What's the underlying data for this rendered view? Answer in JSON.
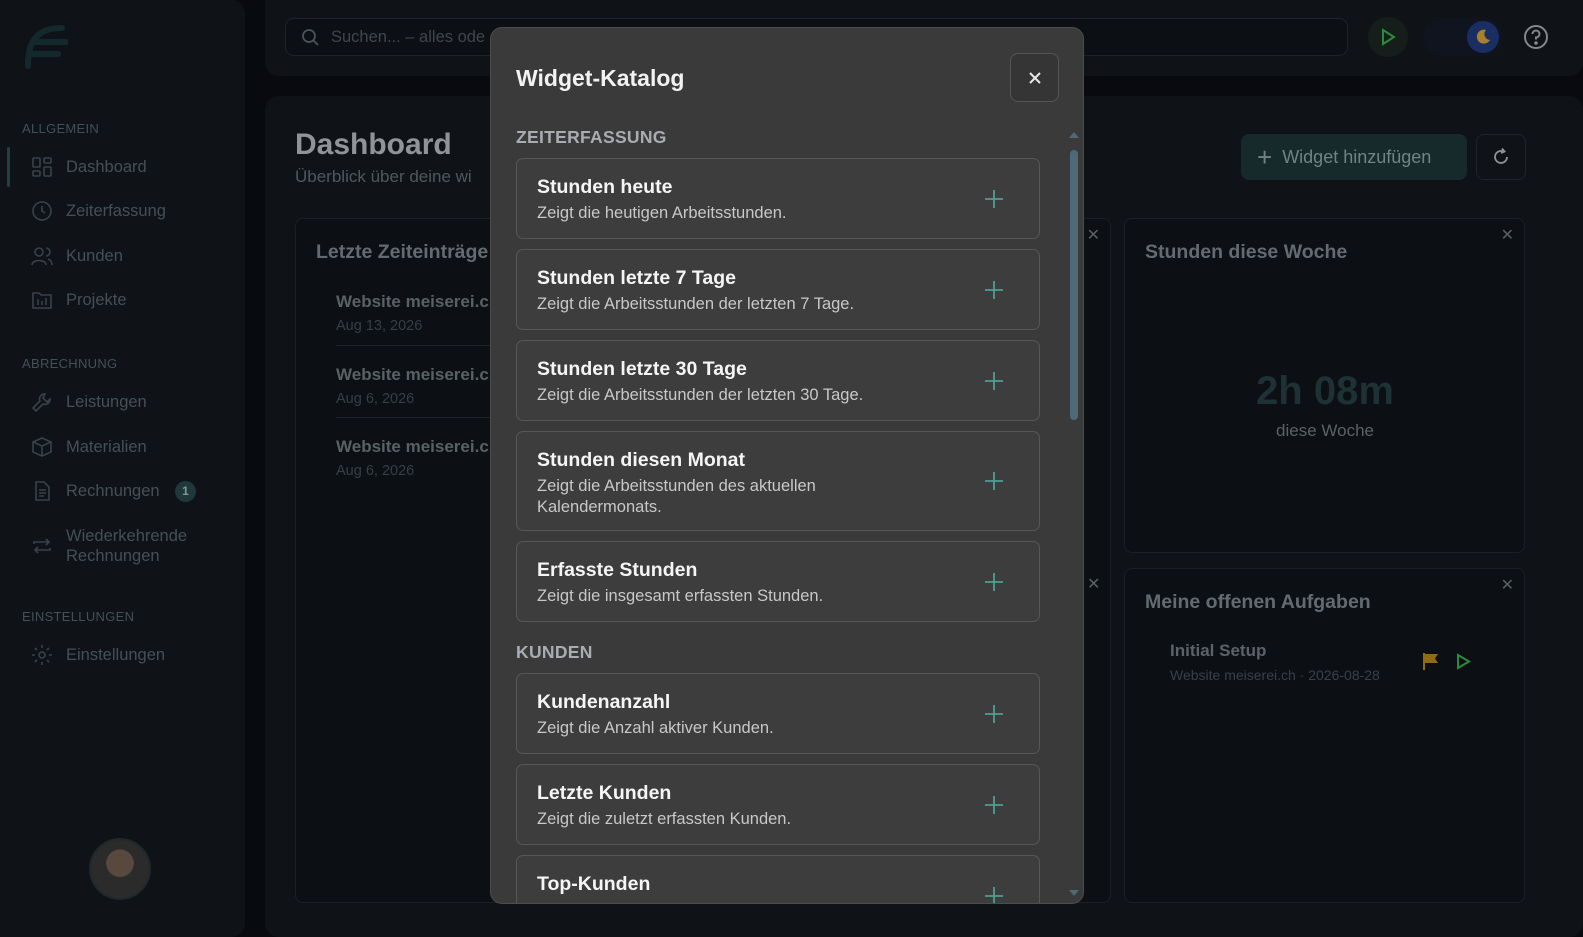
{
  "colors": {
    "accent": "#2b5a5c",
    "modal_bg": "#3a3a3a",
    "play_green": "#3fbf4f",
    "flag_yellow": "#c8951b"
  },
  "sidebar": {
    "sections": [
      {
        "label": "ALLGEMEIN"
      },
      {
        "label": "ABRECHNUNG"
      },
      {
        "label": "EINSTELLUNGEN"
      }
    ],
    "items": [
      {
        "label": "Dashboard",
        "icon": "dashboard-icon"
      },
      {
        "label": "Zeiterfassung",
        "icon": "clock-icon"
      },
      {
        "label": "Kunden",
        "icon": "users-icon"
      },
      {
        "label": "Projekte",
        "icon": "projects-icon"
      },
      {
        "label": "Leistungen",
        "icon": "wrench-icon"
      },
      {
        "label": "Materialien",
        "icon": "box-icon"
      },
      {
        "label": "Rechnungen",
        "icon": "document-icon",
        "badge": "1"
      },
      {
        "label": "Wiederkehrende Rechnungen",
        "icon": "repeat-icon"
      },
      {
        "label": "Einstellungen",
        "icon": "gear-icon"
      }
    ]
  },
  "topbar": {
    "search_placeholder": "Suchen... – alles ode"
  },
  "main": {
    "title": "Dashboard",
    "subtitle": "Überblick über deine wi",
    "add_widget_label": "Widget hinzufügen",
    "cards": {
      "recent": {
        "title": "Letzte Zeiteinträge",
        "entries": [
          {
            "title": "Website meiserei.c",
            "date": "Aug 13, 2026"
          },
          {
            "title": "Website meiserei.c",
            "date": "Aug 6, 2026"
          },
          {
            "title": "Website meiserei.c",
            "date": "Aug 6, 2026"
          }
        ]
      },
      "week": {
        "title": "Stunden diese Woche",
        "value": "2h 08m",
        "caption": "diese Woche"
      },
      "tasks": {
        "title": "Meine offenen Aufgaben",
        "items": [
          {
            "title": "Initial Setup",
            "meta": "Website meiserei.ch · 2026-08-28"
          }
        ]
      }
    }
  },
  "modal": {
    "title": "Widget-Katalog",
    "sections": [
      {
        "label": "ZEITERFASSUNG",
        "widgets": [
          {
            "name": "Stunden heute",
            "desc": "Zeigt die heutigen Arbeitsstunden."
          },
          {
            "name": "Stunden letzte 7 Tage",
            "desc": "Zeigt die Arbeitsstunden der letzten 7 Tage."
          },
          {
            "name": "Stunden letzte 30 Tage",
            "desc": "Zeigt die Arbeitsstunden der letzten 30 Tage."
          },
          {
            "name": "Stunden diesen Monat",
            "desc": "Zeigt die Arbeitsstunden des aktuellen Kalendermonats."
          },
          {
            "name": "Erfasste Stunden",
            "desc": "Zeigt die insgesamt erfassten Stunden."
          }
        ]
      },
      {
        "label": "KUNDEN",
        "widgets": [
          {
            "name": "Kundenanzahl",
            "desc": "Zeigt die Anzahl aktiver Kunden."
          },
          {
            "name": "Letzte Kunden",
            "desc": "Zeigt die zuletzt erfassten Kunden."
          },
          {
            "name": "Top-Kunden",
            "desc": ""
          }
        ]
      }
    ]
  }
}
